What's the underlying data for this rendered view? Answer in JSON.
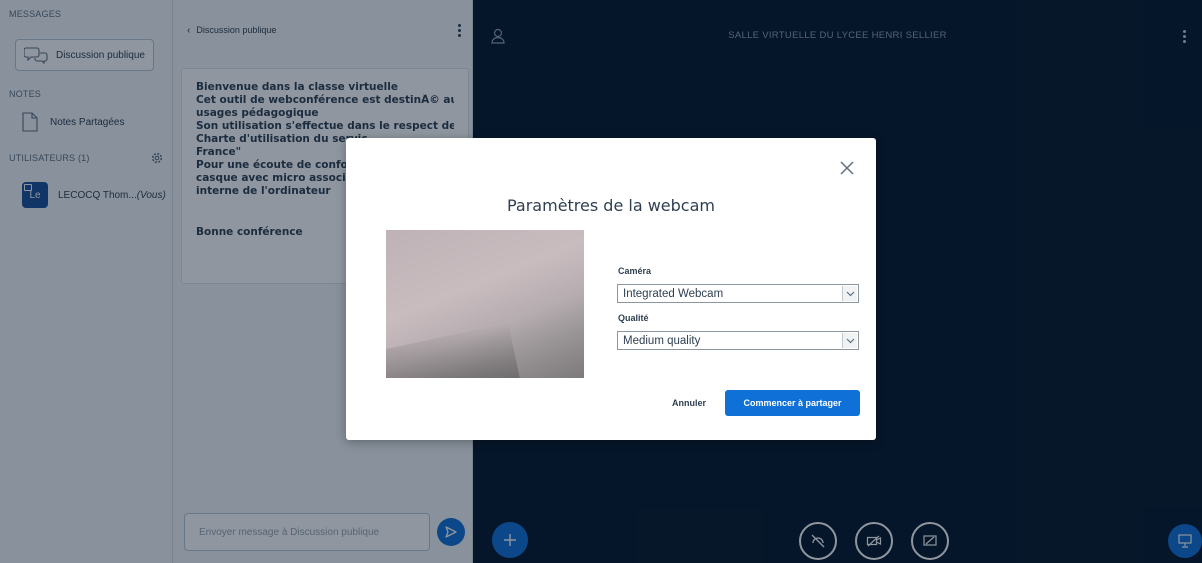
{
  "sidebar": {
    "messages_heading": "MESSAGES",
    "public_chat_label": "Discussion publique",
    "notes_heading": "NOTES",
    "shared_notes_label": "Notes Partagées",
    "users_heading": "UTILISATEURS (1)",
    "user": {
      "initials": "Le",
      "name": "LECOCQ Thom...",
      "you_tag": "(Vous)"
    }
  },
  "chat": {
    "back_label": "Discussion publique",
    "welcome_lines": [
      "Bienvenue dans la classe virtuelle",
      "Cet outil de webconférence est destinÃ© aux",
      "usages pédagogique",
      "Son utilisation s'effectue dans le respect de la",
      "Charte d'utilisation du servic",
      "France\"",
      "Pour une écoute de confort, p",
      "casque avec micro associé pl",
      "interne de l'ordinateur"
    ],
    "closing_line": "Bonne conférence",
    "input_placeholder": "Envoyer message à Discussion publique"
  },
  "stage": {
    "room_title": "SALLE VIRTUELLE DU LYCEE HENRI SELLIER"
  },
  "modal": {
    "title": "Paramètres de la webcam",
    "camera_label": "Caméra",
    "camera_value": "Integrated Webcam",
    "quality_label": "Qualité",
    "quality_value": "Medium quality",
    "cancel_label": "Annuler",
    "share_label": "Commencer à partager"
  },
  "colors": {
    "accent": "#0f70d7",
    "stage_bg": "#06172a",
    "panel_bg": "#f3f6f9",
    "text": "#2f3f51"
  }
}
